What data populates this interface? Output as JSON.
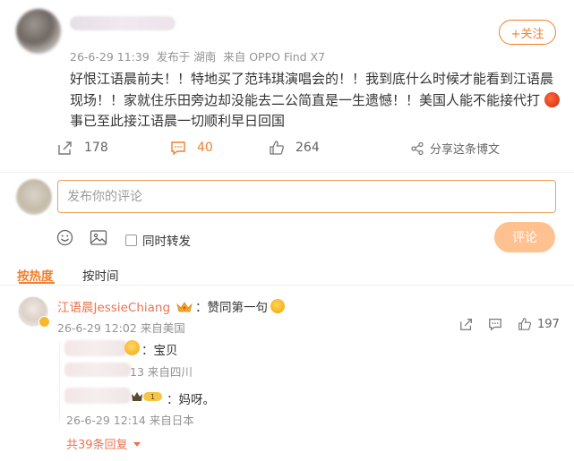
{
  "post": {
    "meta": {
      "time": "26-6-29 11:39",
      "source": "发布于 湖南",
      "device": "来自 OPPO Find X7"
    },
    "follow_label": "+关注",
    "text_part1": "好恨江语晨前夫！！特地买了范玮琪演唱会的！！我到底什么时候才能看到江语晨现场！！家就住乐田旁边却没能去二公简直是一生遗憾！！美国人能不能接代打",
    "text_part2": "事已至此接江语晨一切顺利早日回国",
    "actions": {
      "repost_count": "178",
      "comment_count": "40",
      "like_count": "264",
      "share_label": "分享这条博文"
    }
  },
  "compose": {
    "placeholder": "发布你的评论",
    "repost_toggle_label": "同时转发",
    "submit_label": "评论"
  },
  "sort_tabs": {
    "hot": "按热度",
    "time": "按时间"
  },
  "comment": {
    "username": "江语晨JessieChiang",
    "text": "：赞同第一句",
    "time": "26-6-29 12:02",
    "location": "来自美国",
    "like_count": "197",
    "replies": [
      {
        "text": "：宝贝",
        "meta": "13 来自四川"
      },
      {
        "text": "：妈呀。",
        "meta": "26-6-29 12:14 来自日本"
      }
    ],
    "more_replies": "共39条回复"
  },
  "colors": {
    "accent": "#f27e2d",
    "username": "#eb7350",
    "muted": "#939393",
    "submit_disabled": "#ffc18f"
  }
}
